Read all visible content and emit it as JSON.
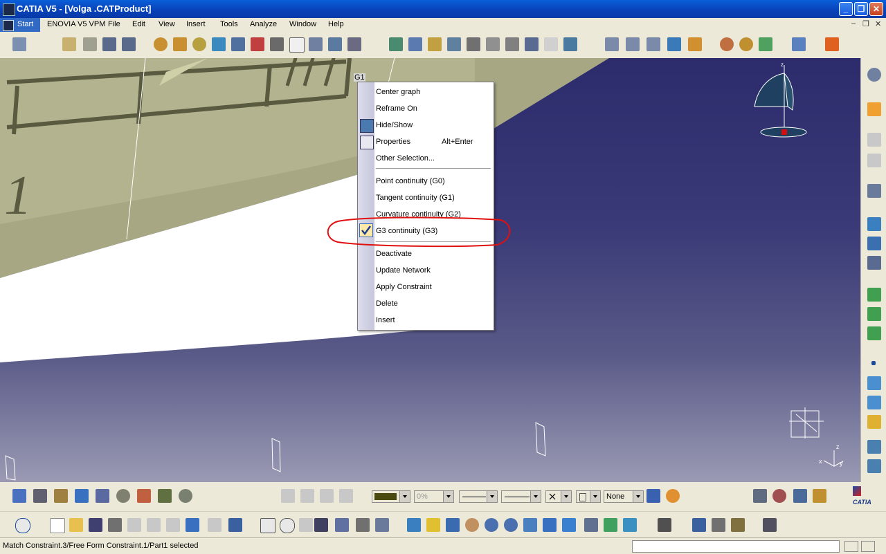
{
  "window": {
    "title": "CATIA V5 - [Volga .CATProduct]",
    "minimize_glyph": "_",
    "restore_glyph": "❐",
    "close_glyph": "✕"
  },
  "menubar": {
    "items": [
      "Start",
      "ENOVIA V5 VPM",
      "File",
      "Edit",
      "View",
      "Insert",
      "Tools",
      "Analyze",
      "Window",
      "Help"
    ],
    "mdi_minimize": "–",
    "mdi_restore": "❐",
    "mdi_close": "✕"
  },
  "viewport": {
    "tag_label": "G1",
    "drawing_text": "1"
  },
  "context_menu": {
    "items": [
      {
        "label": "Center graph"
      },
      {
        "label": "Reframe On"
      },
      {
        "label": "Hide/Show",
        "icon": "hide-show-icon"
      },
      {
        "label": "Properties",
        "shortcut": "Alt+Enter",
        "icon": "properties-icon"
      },
      {
        "label": "Other Selection..."
      }
    ],
    "continuity": [
      {
        "label": "Point continuity (G0)"
      },
      {
        "label": "Tangent continuity (G1)"
      },
      {
        "label": "Curvature continuity (G2)"
      },
      {
        "label": "G3 continuity (G3)",
        "checked": true
      }
    ],
    "actions": [
      {
        "label": "Deactivate"
      },
      {
        "label": "Update Network"
      },
      {
        "label": "Apply Constraint"
      },
      {
        "label": "Delete"
      },
      {
        "label": "Insert"
      }
    ]
  },
  "properties_toolbar": {
    "color_value": "",
    "transparency_value": "0%",
    "line_weight_value": "",
    "line_type_value": "",
    "point_symbol_value": "",
    "layer_value": "None"
  },
  "branding": {
    "logo_text": "CATIA"
  },
  "statusbar": {
    "message": "Match Constraint.3/Free Form Constraint.1/Part1 selected",
    "command_value": ""
  },
  "colors": {
    "title_bar": "#0841b8",
    "menu_highlight": "#316ac5",
    "annotation_circle": "#e01010",
    "surface": "#9fa07a",
    "viewport_background": "#3a3a78"
  }
}
